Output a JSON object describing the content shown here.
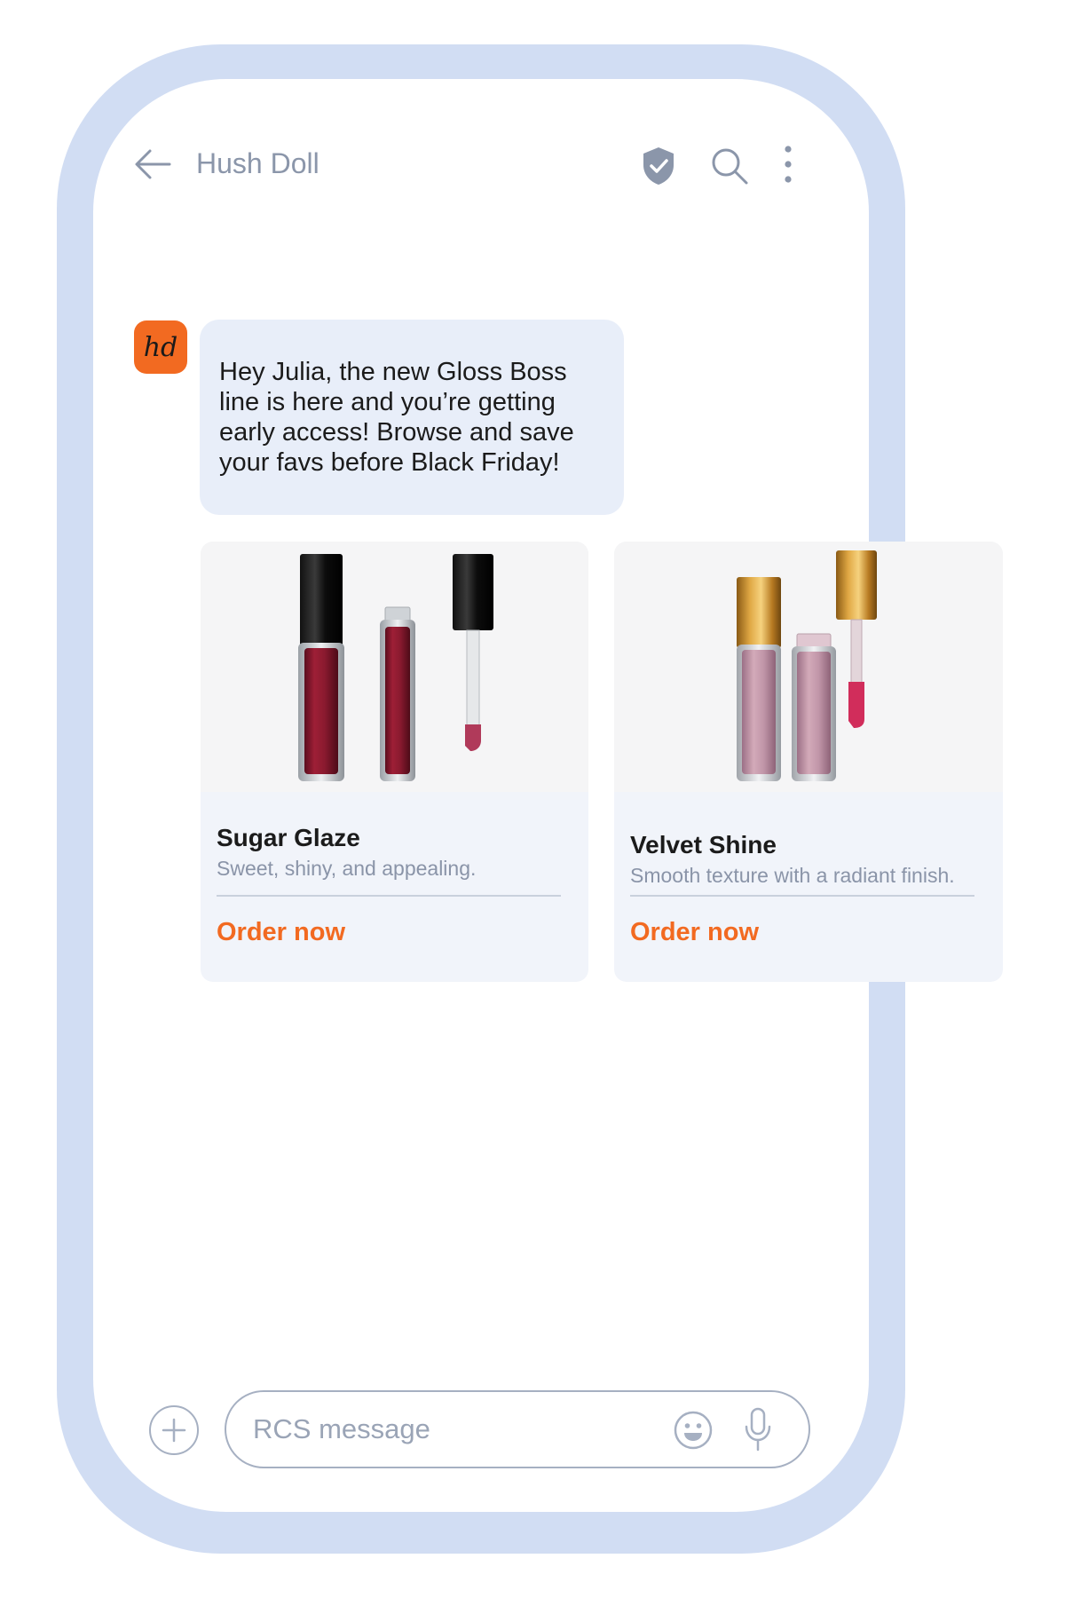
{
  "header": {
    "contact_name": "Hush Doll",
    "icons": [
      "back-arrow-icon",
      "verified-shield-icon",
      "search-icon",
      "more-vertical-icon"
    ]
  },
  "avatar": {
    "initials": "hd",
    "color": "#f26a21"
  },
  "message": {
    "text": "Hey Julia, the new Gloss Boss line is here and you’re getting early access! Browse and save your favs before Black Friday!"
  },
  "cards": [
    {
      "title": "Sugar Glaze",
      "description": "Sweet, shiny, and appealing.",
      "action_label": "Order now",
      "image": "red-lip-gloss-with-black-cap"
    },
    {
      "title": "Velvet Shine",
      "description": "Smooth texture with a radiant finish.",
      "action_label": "Order now",
      "image": "pink-lip-gloss-with-gold-cap"
    }
  ],
  "composer": {
    "placeholder": "RCS message",
    "icons": [
      "add-icon",
      "emoji-icon",
      "microphone-icon"
    ]
  },
  "colors": {
    "accent": "#f26a21",
    "frame": "#d1ddf3",
    "bubble": "#e8eef9",
    "card_background": "#f1f4fa",
    "muted_text": "#8b96aa"
  }
}
